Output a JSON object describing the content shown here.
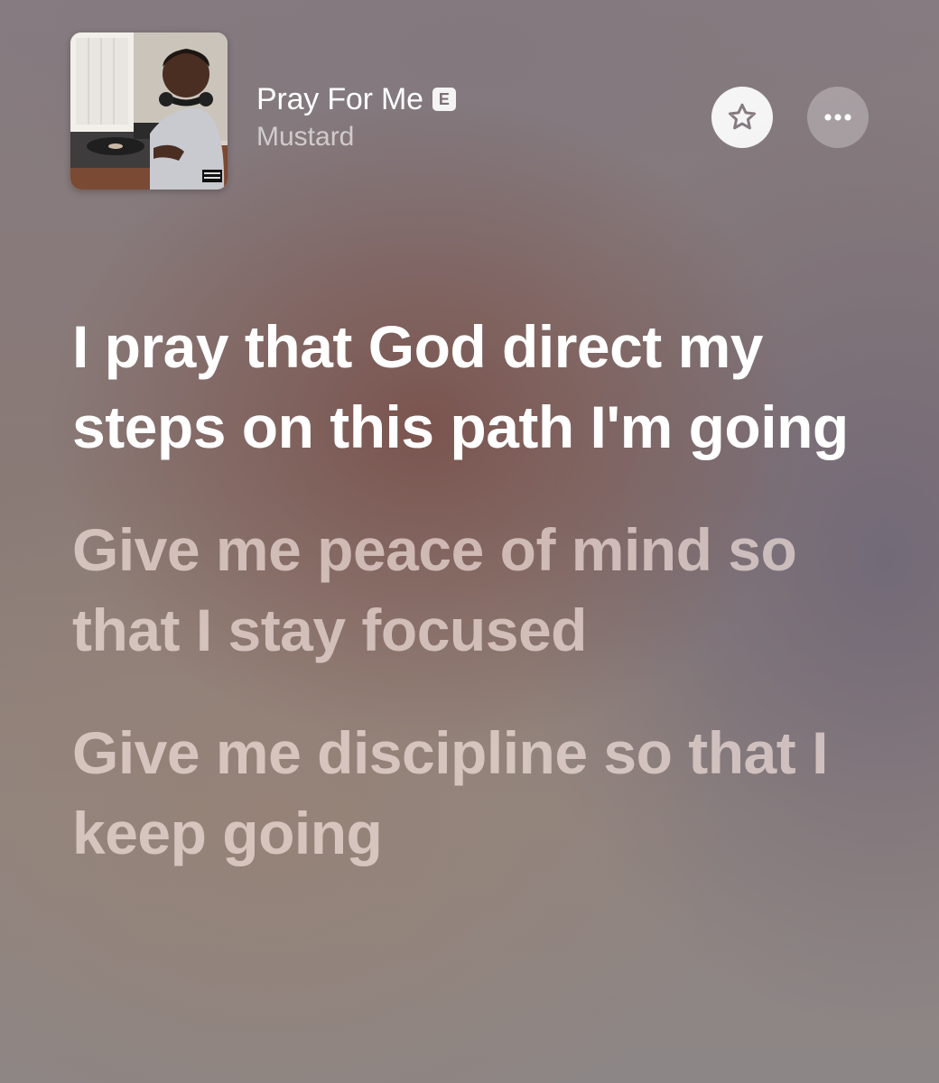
{
  "now_playing": {
    "title": "Pray For Me",
    "explicit_badge": "E",
    "artist": "Mustard",
    "artwork_icon": "album-artwork"
  },
  "actions": {
    "favorite_icon": "star-icon",
    "more_icon": "ellipsis-icon"
  },
  "lyrics": [
    {
      "text": "I pray that God direct my steps on this path I'm going",
      "state": "active"
    },
    {
      "text": "Give me peace of mind so that I stay focused",
      "state": "upcoming"
    },
    {
      "text": "Give me discipline so that I keep going",
      "state": "upcoming"
    }
  ],
  "colors": {
    "active_lyric": "#ffffff",
    "upcoming_lyric": "#ffeee8",
    "badge_text": "#7b6f72"
  }
}
